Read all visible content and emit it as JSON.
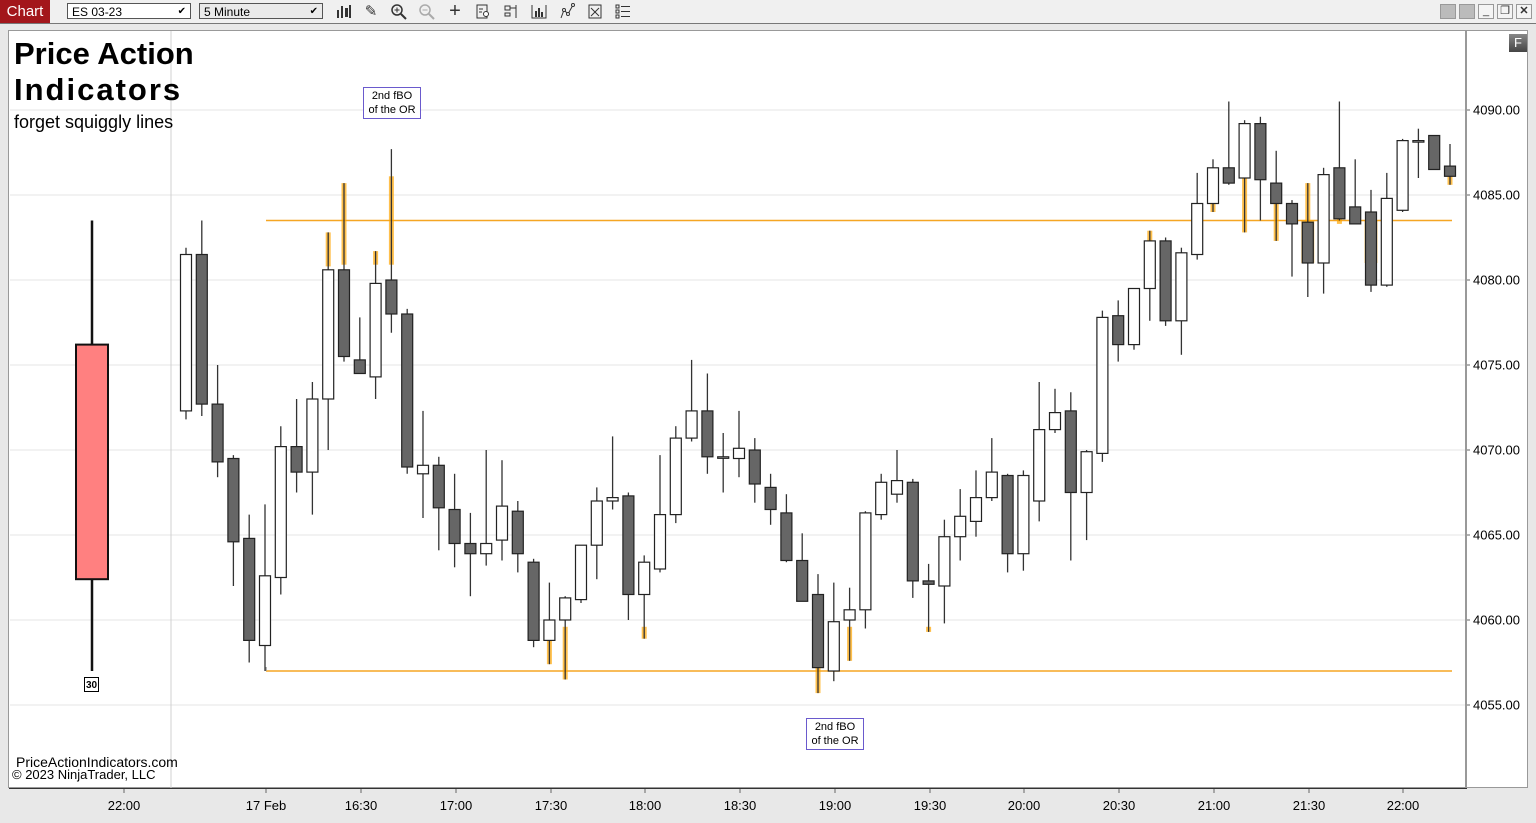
{
  "toolbar": {
    "tab_label": "Chart",
    "instrument": "ES 03-23",
    "interval": "5 Minute",
    "icons": [
      "bars-type-icon",
      "pencil-draw-icon",
      "zoom-in-icon",
      "zoom-out-icon",
      "crosshair-icon",
      "data-box-icon",
      "chart-trader-icon",
      "indicators-icon",
      "strategies-icon",
      "properties-icon",
      "list-icon"
    ],
    "window_buttons": [
      "tile-icon",
      "tile-icon",
      "minimize-icon",
      "restore-icon",
      "close-icon"
    ]
  },
  "branding": {
    "line1": "Price Action",
    "line2": "Indicators",
    "line3": "forget squiggly lines",
    "site": "PriceActionIndicators.com",
    "copyright": "© 2023 NinjaTrader, LLC",
    "f_button": "F"
  },
  "annotations": [
    {
      "text1": "2nd fBO",
      "text2": "of the OR",
      "position": "top"
    },
    {
      "text1": "2nd fBO",
      "text2": "of the OR",
      "position": "bottom"
    }
  ],
  "colors": {
    "bull_fill": "#ffffff",
    "bear_fill": "#666666",
    "outline": "#222222",
    "highlight": "#ffa500",
    "orange_line": "#f5a623",
    "aggregate_fill": "#ff8080",
    "note_border": "#6a5acd"
  },
  "chart_data": {
    "type": "candlestick",
    "instrument": "ES 03-23",
    "interval": "5 Minute",
    "y_axis": {
      "min": 4052.5,
      "max": 4094,
      "ticks": [
        4055,
        4060,
        4065,
        4070,
        4075,
        4080,
        4085,
        4090
      ],
      "labels": [
        "4055.00",
        "4060.00",
        "4065.00",
        "4070.00",
        "4075.00",
        "4080.00",
        "4085.00",
        "4090.00"
      ],
      "position": "right",
      "grid": true
    },
    "x_axis": {
      "labels": [
        "22:00",
        "17 Feb",
        "16:30",
        "17:00",
        "17:30",
        "18:00",
        "18:30",
        "19:00",
        "19:30",
        "20:00",
        "20:30",
        "21:00",
        "21:30",
        "22:00"
      ]
    },
    "opening_range": {
      "high": 4083.5,
      "low": 4057.0
    },
    "aggregate_bar": {
      "label": "30",
      "open": 4076.2,
      "high": 4083.5,
      "low": 4057.0,
      "close": 4062.4
    },
    "candles": [
      {
        "o": 4072.3,
        "h": 4081.9,
        "l": 4071.8,
        "c": 4081.5
      },
      {
        "o": 4081.5,
        "h": 4083.5,
        "l": 4072.0,
        "c": 4072.7
      },
      {
        "o": 4072.7,
        "h": 4075.0,
        "l": 4068.4,
        "c": 4069.3
      },
      {
        "o": 4069.5,
        "h": 4069.7,
        "l": 4062.0,
        "c": 4064.6
      },
      {
        "o": 4064.8,
        "h": 4066.2,
        "l": 4057.5,
        "c": 4058.8
      },
      {
        "o": 4058.5,
        "h": 4066.8,
        "l": 4057.0,
        "c": 4062.6
      },
      {
        "o": 4062.5,
        "h": 4071.4,
        "l": 4061.5,
        "c": 4070.2
      },
      {
        "o": 4070.2,
        "h": 4073.0,
        "l": 4067.5,
        "c": 4068.7
      },
      {
        "o": 4068.7,
        "h": 4074.0,
        "l": 4066.2,
        "c": 4073.0
      },
      {
        "o": 4073.0,
        "h": 4082.8,
        "l": 4070.0,
        "c": 4080.6
      },
      {
        "o": 4080.6,
        "h": 4085.7,
        "l": 4075.2,
        "c": 4075.5
      },
      {
        "o": 4075.3,
        "h": 4077.8,
        "l": 4074.5,
        "c": 4074.5
      },
      {
        "o": 4074.3,
        "h": 4081.7,
        "l": 4073.0,
        "c": 4079.8
      },
      {
        "o": 4080.0,
        "h": 4087.7,
        "l": 4076.9,
        "c": 4078.0
      },
      {
        "o": 4078.0,
        "h": 4078.3,
        "l": 4068.6,
        "c": 4069.0
      },
      {
        "o": 4068.6,
        "h": 4072.3,
        "l": 4066.0,
        "c": 4069.1
      },
      {
        "o": 4069.1,
        "h": 4069.6,
        "l": 4064.1,
        "c": 4066.6
      },
      {
        "o": 4066.5,
        "h": 4068.6,
        "l": 4063.1,
        "c": 4064.5
      },
      {
        "o": 4064.5,
        "h": 4066.3,
        "l": 4061.4,
        "c": 4063.9
      },
      {
        "o": 4063.9,
        "h": 4070.0,
        "l": 4063.2,
        "c": 4064.5
      },
      {
        "o": 4064.7,
        "h": 4069.4,
        "l": 4063.5,
        "c": 4066.7
      },
      {
        "o": 4066.4,
        "h": 4067.0,
        "l": 4062.8,
        "c": 4063.9
      },
      {
        "o": 4063.4,
        "h": 4063.6,
        "l": 4058.4,
        "c": 4058.8
      },
      {
        "o": 4058.8,
        "h": 4062.2,
        "l": 4057.4,
        "c": 4060.0
      },
      {
        "o": 4060.0,
        "h": 4061.4,
        "l": 4056.5,
        "c": 4061.3
      },
      {
        "o": 4061.2,
        "h": 4064.2,
        "l": 4061.0,
        "c": 4064.4
      },
      {
        "o": 4064.4,
        "h": 4067.8,
        "l": 4062.4,
        "c": 4067.0
      },
      {
        "o": 4067.0,
        "h": 4070.8,
        "l": 4066.5,
        "c": 4067.2
      },
      {
        "o": 4067.3,
        "h": 4067.5,
        "l": 4060.0,
        "c": 4061.5
      },
      {
        "o": 4061.5,
        "h": 4063.8,
        "l": 4058.9,
        "c": 4063.4
      },
      {
        "o": 4063.0,
        "h": 4069.7,
        "l": 4062.8,
        "c": 4066.2
      },
      {
        "o": 4066.2,
        "h": 4071.4,
        "l": 4065.7,
        "c": 4070.7
      },
      {
        "o": 4070.7,
        "h": 4075.3,
        "l": 4070.5,
        "c": 4072.3
      },
      {
        "o": 4072.3,
        "h": 4074.5,
        "l": 4068.6,
        "c": 4069.6
      },
      {
        "o": 4069.6,
        "h": 4071.0,
        "l": 4067.5,
        "c": 4069.6
      },
      {
        "o": 4069.5,
        "h": 4072.3,
        "l": 4068.4,
        "c": 4070.1
      },
      {
        "o": 4070.0,
        "h": 4070.7,
        "l": 4066.9,
        "c": 4068.0
      },
      {
        "o": 4067.8,
        "h": 4068.6,
        "l": 4065.6,
        "c": 4066.5
      },
      {
        "o": 4066.3,
        "h": 4067.4,
        "l": 4063.4,
        "c": 4063.5
      },
      {
        "o": 4063.5,
        "h": 4065.1,
        "l": 4061.8,
        "c": 4061.1
      },
      {
        "o": 4061.5,
        "h": 4062.7,
        "l": 4055.7,
        "c": 4057.2
      },
      {
        "o": 4057.0,
        "h": 4062.2,
        "l": 4056.4,
        "c": 4059.9
      },
      {
        "o": 4060.0,
        "h": 4061.9,
        "l": 4057.6,
        "c": 4060.6
      },
      {
        "o": 4060.6,
        "h": 4066.4,
        "l": 4059.5,
        "c": 4066.3
      },
      {
        "o": 4066.2,
        "h": 4068.6,
        "l": 4065.9,
        "c": 4068.1
      },
      {
        "o": 4067.4,
        "h": 4070.0,
        "l": 4066.9,
        "c": 4068.2
      },
      {
        "o": 4068.1,
        "h": 4068.3,
        "l": 4061.3,
        "c": 4062.3
      },
      {
        "o": 4062.3,
        "h": 4063.3,
        "l": 4059.3,
        "c": 4062.1
      },
      {
        "o": 4062.0,
        "h": 4065.9,
        "l": 4059.8,
        "c": 4064.9
      },
      {
        "o": 4064.9,
        "h": 4067.7,
        "l": 4063.5,
        "c": 4066.1
      },
      {
        "o": 4065.8,
        "h": 4068.8,
        "l": 4064.9,
        "c": 4067.2
      },
      {
        "o": 4067.2,
        "h": 4070.7,
        "l": 4067.0,
        "c": 4068.7
      },
      {
        "o": 4068.5,
        "h": 4068.6,
        "l": 4062.8,
        "c": 4063.9
      },
      {
        "o": 4063.9,
        "h": 4068.8,
        "l": 4062.9,
        "c": 4068.5
      },
      {
        "o": 4067.0,
        "h": 4074.0,
        "l": 4065.8,
        "c": 4071.2
      },
      {
        "o": 4071.2,
        "h": 4073.6,
        "l": 4071.0,
        "c": 4072.2
      },
      {
        "o": 4072.3,
        "h": 4073.4,
        "l": 4063.5,
        "c": 4067.5
      },
      {
        "o": 4067.5,
        "h": 4070.0,
        "l": 4064.7,
        "c": 4069.9
      },
      {
        "o": 4069.8,
        "h": 4078.2,
        "l": 4069.3,
        "c": 4077.8
      },
      {
        "o": 4077.9,
        "h": 4078.8,
        "l": 4075.2,
        "c": 4076.2
      },
      {
        "o": 4076.2,
        "h": 4079.5,
        "l": 4075.9,
        "c": 4079.5
      },
      {
        "o": 4079.5,
        "h": 4082.9,
        "l": 4077.6,
        "c": 4082.3
      },
      {
        "o": 4082.3,
        "h": 4082.5,
        "l": 4077.3,
        "c": 4077.6
      },
      {
        "o": 4077.6,
        "h": 4081.9,
        "l": 4075.6,
        "c": 4081.6
      },
      {
        "o": 4081.5,
        "h": 4086.3,
        "l": 4081.2,
        "c": 4084.5
      },
      {
        "o": 4084.5,
        "h": 4087.1,
        "l": 4084.0,
        "c": 4086.6
      },
      {
        "o": 4086.6,
        "h": 4090.5,
        "l": 4085.6,
        "c": 4085.7
      },
      {
        "o": 4086.0,
        "h": 4089.4,
        "l": 4082.8,
        "c": 4089.2
      },
      {
        "o": 4089.2,
        "h": 4089.6,
        "l": 4083.5,
        "c": 4085.9
      },
      {
        "o": 4085.7,
        "h": 4087.6,
        "l": 4082.3,
        "c": 4084.5
      },
      {
        "o": 4084.5,
        "h": 4084.7,
        "l": 4080.2,
        "c": 4083.3
      },
      {
        "o": 4083.4,
        "h": 4085.7,
        "l": 4079.0,
        "c": 4081.0
      },
      {
        "o": 4081.0,
        "h": 4086.6,
        "l": 4079.2,
        "c": 4086.2
      },
      {
        "o": 4086.6,
        "h": 4090.5,
        "l": 4083.5,
        "c": 4083.6
      },
      {
        "o": 4084.3,
        "h": 4087.1,
        "l": 4083.3,
        "c": 4083.3
      },
      {
        "o": 4084.0,
        "h": 4085.3,
        "l": 4079.3,
        "c": 4079.7
      },
      {
        "o": 4079.7,
        "h": 4086.3,
        "l": 4079.6,
        "c": 4084.8
      },
      {
        "o": 4084.1,
        "h": 4088.3,
        "l": 4084.0,
        "c": 4088.2
      },
      {
        "o": 4088.2,
        "h": 4088.9,
        "l": 4086.0,
        "c": 4088.2
      },
      {
        "o": 4088.5,
        "h": 4088.5,
        "l": 4086.5,
        "c": 4086.5
      },
      {
        "o": 4086.7,
        "h": 4088.0,
        "l": 4085.6,
        "c": 4086.1
      }
    ],
    "highlights": [
      {
        "bar": 9,
        "from": 4080.8,
        "to": 4082.8
      },
      {
        "bar": 10,
        "from": 4080.9,
        "to": 4085.7
      },
      {
        "bar": 12,
        "from": 4080.9,
        "to": 4081.7
      },
      {
        "bar": 13,
        "from": 4080.9,
        "to": 4086.1
      },
      {
        "bar": 23,
        "from": 4057.4,
        "to": 4059.0
      },
      {
        "bar": 24,
        "from": 4056.5,
        "to": 4059.6
      },
      {
        "bar": 29,
        "from": 4058.9,
        "to": 4059.6
      },
      {
        "bar": 40,
        "from": 4055.7,
        "to": 4057.2
      },
      {
        "bar": 42,
        "from": 4057.6,
        "to": 4059.6
      },
      {
        "bar": 47,
        "from": 4059.3,
        "to": 4059.6
      },
      {
        "bar": 61,
        "from": 4082.3,
        "to": 4082.9
      },
      {
        "bar": 65,
        "from": 4084.0,
        "to": 4084.5
      },
      {
        "bar": 67,
        "from": 4082.8,
        "to": 4086.0
      },
      {
        "bar": 69,
        "from": 4082.3,
        "to": 4084.5
      },
      {
        "bar": 71,
        "from": 4081.0,
        "to": 4085.7
      },
      {
        "bar": 71,
        "from": 4081.0,
        "to": 4083.5,
        "body": true
      },
      {
        "bar": 73,
        "from": 4083.3,
        "to": 4083.6
      },
      {
        "bar": 74,
        "from": 4083.3,
        "to": 4083.5
      },
      {
        "bar": 75,
        "from": 4081.0,
        "to": 4083.5,
        "body": true
      },
      {
        "bar": 76,
        "from": 4084.0,
        "to": 4084.1
      },
      {
        "bar": 80,
        "from": 4085.6,
        "to": 4086.1
      }
    ]
  }
}
